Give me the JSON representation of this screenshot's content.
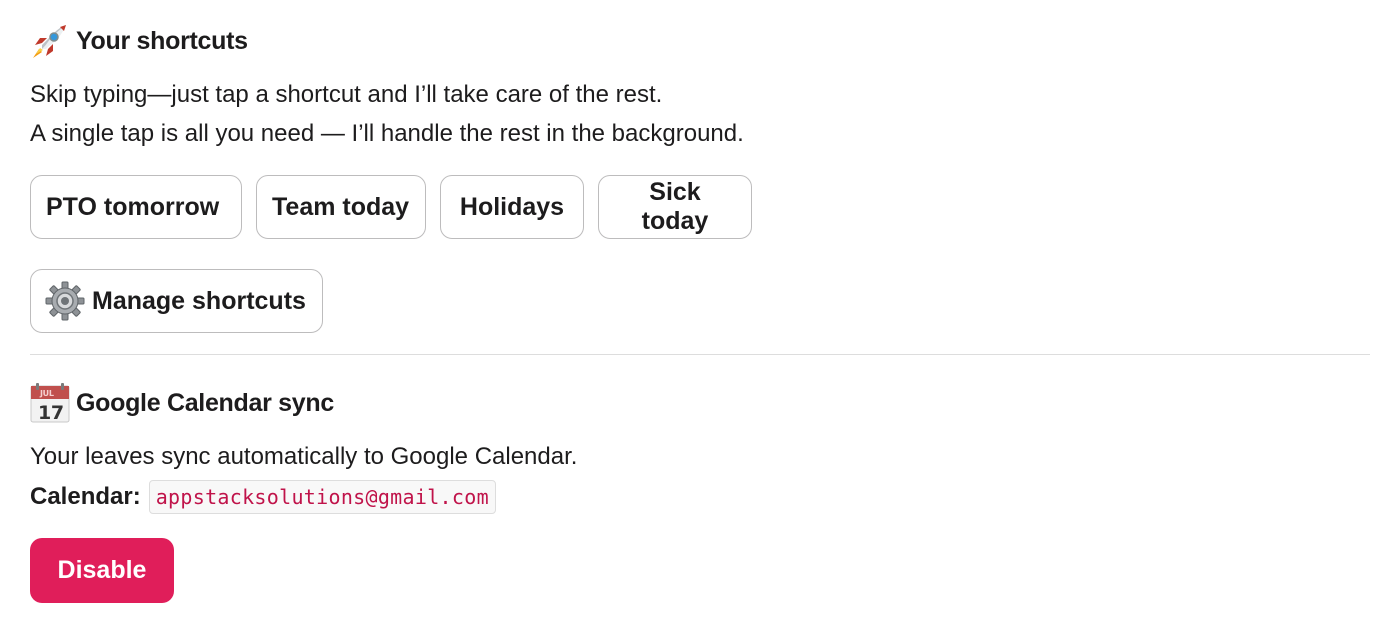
{
  "shortcuts": {
    "icon": "rocket-icon",
    "title": "Your shortcuts",
    "line1": "Skip typing—just tap a shortcut and I’ll take care of the rest.",
    "line2": "A single tap is all you need — I’ll handle the rest in the background.",
    "buttons": [
      {
        "label": "PTO tomorrow"
      },
      {
        "label": "Team today"
      },
      {
        "label": "Holidays"
      },
      {
        "label": "Sick today"
      }
    ],
    "manage": {
      "icon": "gear-icon",
      "label": "Manage shortcuts"
    }
  },
  "calendar": {
    "icon": "calendar-icon",
    "icon_month": "JUL",
    "icon_day": "17",
    "title": "Google Calendar sync",
    "description": "Your leaves sync automatically to Google Calendar.",
    "calendar_label": "Calendar:",
    "calendar_value": "appstacksolutions@gmail.com",
    "disable_label": "Disable"
  },
  "colors": {
    "danger": "#e01e5a",
    "code_text": "#c0134a",
    "border": "#bdbcbd",
    "text": "#1d1c1d"
  }
}
